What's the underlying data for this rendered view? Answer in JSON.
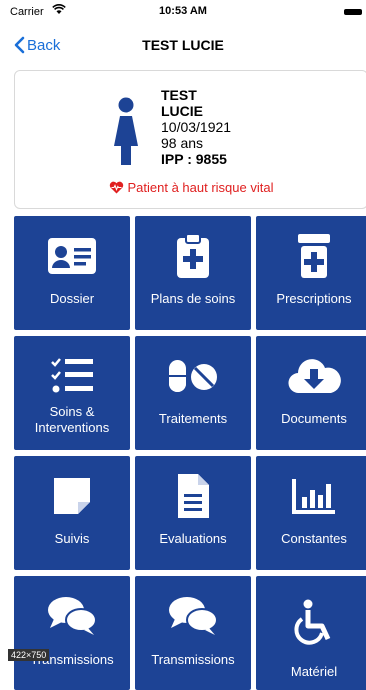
{
  "status_bar": {
    "carrier": "Carrier",
    "time": "10:53 AM"
  },
  "nav": {
    "back_label": "Back",
    "title": "TEST LUCIE"
  },
  "patient": {
    "last_name": "TEST",
    "first_name": "LUCIE",
    "birth_date": "10/03/1921",
    "age": "98 ans",
    "ipp": "IPP : 9855",
    "risk_alert": "Patient à haut risque vital"
  },
  "tiles": [
    {
      "label": "Dossier",
      "icon": "id-card-icon"
    },
    {
      "label": "Plans de soins",
      "icon": "clipboard-medical-icon"
    },
    {
      "label": "Prescriptions",
      "icon": "pill-bottle-icon"
    },
    {
      "label": "Soins & Interventions",
      "icon": "checklist-icon"
    },
    {
      "label": "Traitements",
      "icon": "pills-icon"
    },
    {
      "label": "Documents",
      "icon": "cloud-download-icon"
    },
    {
      "label": "Suivis",
      "icon": "sticky-note-icon"
    },
    {
      "label": "Evaluations",
      "icon": "document-icon"
    },
    {
      "label": "Constantes",
      "icon": "bar-chart-icon"
    },
    {
      "label": "Transmissions",
      "icon": "chat-bubbles-icon"
    },
    {
      "label": "Transmissions",
      "icon": "chat-bubbles-icon"
    },
    {
      "label": "Matériel",
      "icon": "wheelchair-icon"
    }
  ],
  "colors": {
    "tile_bg": "#1d4395",
    "accent": "#1a6fd8",
    "alert": "#e02020"
  },
  "overlay_badge": "422×750"
}
